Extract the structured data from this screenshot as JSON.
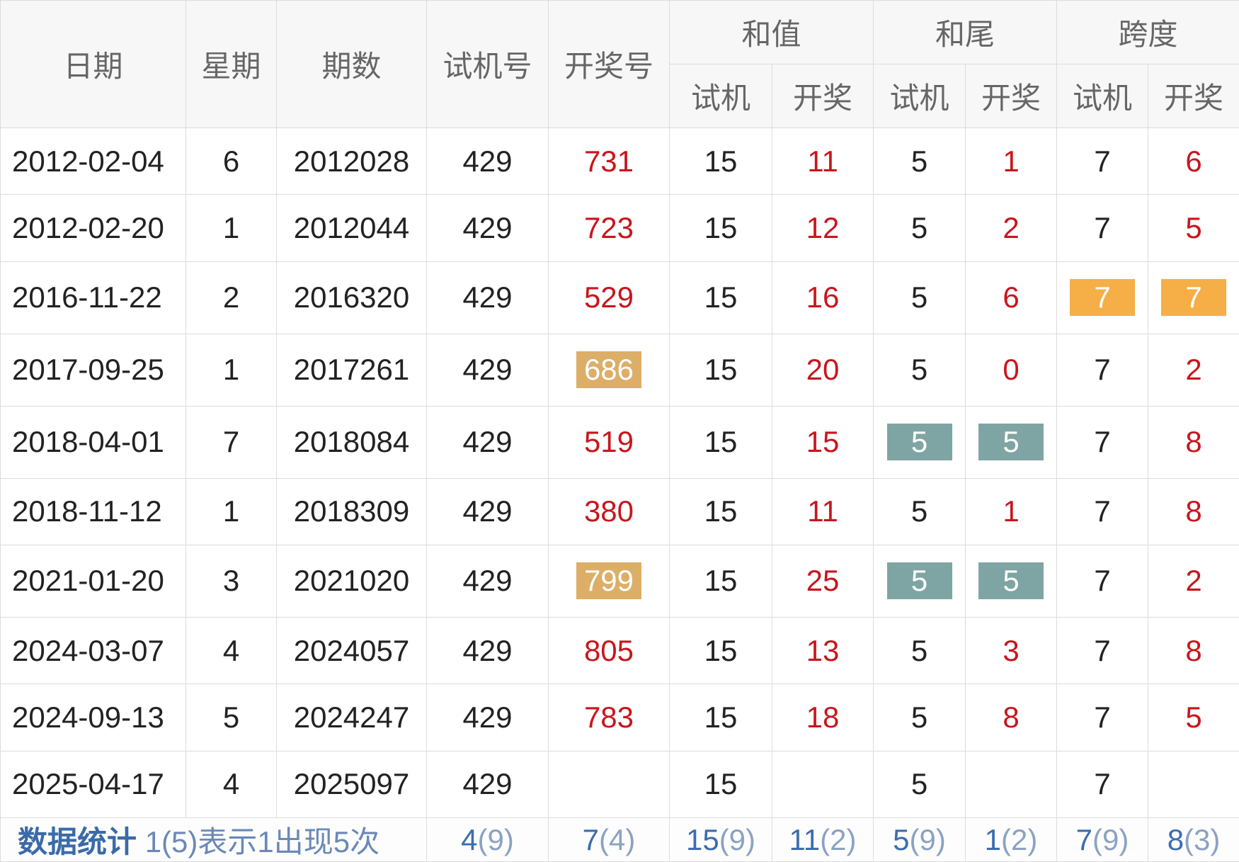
{
  "headers": {
    "date": "日期",
    "weekday": "星期",
    "period": "期数",
    "trial": "试机号",
    "draw": "开奖号",
    "sum": "和值",
    "tail": "和尾",
    "span": "跨度",
    "sub_trial": "试机",
    "sub_draw": "开奖"
  },
  "rows": [
    {
      "date": "2012-02-04",
      "weekday": "6",
      "period": "2012028",
      "trial": "429",
      "draw": "731",
      "sum_trial": "15",
      "sum_draw": "11",
      "tail_trial": "5",
      "tail_draw": "1",
      "span_trial": "7",
      "span_draw": "6"
    },
    {
      "date": "2012-02-20",
      "weekday": "1",
      "period": "2012044",
      "trial": "429",
      "draw": "723",
      "sum_trial": "15",
      "sum_draw": "12",
      "tail_trial": "5",
      "tail_draw": "2",
      "span_trial": "7",
      "span_draw": "5"
    },
    {
      "date": "2016-11-22",
      "weekday": "2",
      "period": "2016320",
      "trial": "429",
      "draw": "529",
      "sum_trial": "15",
      "sum_draw": "16",
      "tail_trial": "5",
      "tail_draw": "6",
      "span_trial": "7",
      "span_draw": "7"
    },
    {
      "date": "2017-09-25",
      "weekday": "1",
      "period": "2017261",
      "trial": "429",
      "draw": "686",
      "sum_trial": "15",
      "sum_draw": "20",
      "tail_trial": "5",
      "tail_draw": "0",
      "span_trial": "7",
      "span_draw": "2"
    },
    {
      "date": "2018-04-01",
      "weekday": "7",
      "period": "2018084",
      "trial": "429",
      "draw": "519",
      "sum_trial": "15",
      "sum_draw": "15",
      "tail_trial": "5",
      "tail_draw": "5",
      "span_trial": "7",
      "span_draw": "8"
    },
    {
      "date": "2018-11-12",
      "weekday": "1",
      "period": "2018309",
      "trial": "429",
      "draw": "380",
      "sum_trial": "15",
      "sum_draw": "11",
      "tail_trial": "5",
      "tail_draw": "1",
      "span_trial": "7",
      "span_draw": "8"
    },
    {
      "date": "2021-01-20",
      "weekday": "3",
      "period": "2021020",
      "trial": "429",
      "draw": "799",
      "sum_trial": "15",
      "sum_draw": "25",
      "tail_trial": "5",
      "tail_draw": "5",
      "span_trial": "7",
      "span_draw": "2"
    },
    {
      "date": "2024-03-07",
      "weekday": "4",
      "period": "2024057",
      "trial": "429",
      "draw": "805",
      "sum_trial": "15",
      "sum_draw": "13",
      "tail_trial": "5",
      "tail_draw": "3",
      "span_trial": "7",
      "span_draw": "8"
    },
    {
      "date": "2024-09-13",
      "weekday": "5",
      "period": "2024247",
      "trial": "429",
      "draw": "783",
      "sum_trial": "15",
      "sum_draw": "18",
      "tail_trial": "5",
      "tail_draw": "8",
      "span_trial": "7",
      "span_draw": "5"
    },
    {
      "date": "2025-04-17",
      "weekday": "4",
      "period": "2025097",
      "trial": "429",
      "draw": "",
      "sum_trial": "15",
      "sum_draw": "",
      "tail_trial": "5",
      "tail_draw": "",
      "span_trial": "7",
      "span_draw": ""
    }
  ],
  "highlights": {
    "tan": "#dcae67",
    "teal": "#7ea5a3",
    "orange": "#f6ae46",
    "draw_number_red": "#c8161d"
  },
  "stats": {
    "title": "数据统计",
    "note": "1(5)表示1出现5次",
    "trial": {
      "num": "4",
      "count": "(9)"
    },
    "draw": {
      "num": "7",
      "count": "(4)"
    },
    "sum_trial": {
      "num": "15",
      "count": "(9)"
    },
    "sum_draw": {
      "num": "11",
      "count": "(2)"
    },
    "tail_trial": {
      "num": "5",
      "count": "(9)"
    },
    "tail_draw": {
      "num": "1",
      "count": "(2)"
    },
    "span_trial": {
      "num": "7",
      "count": "(9)"
    },
    "span_draw": {
      "num": "8",
      "count": "(3)"
    }
  }
}
